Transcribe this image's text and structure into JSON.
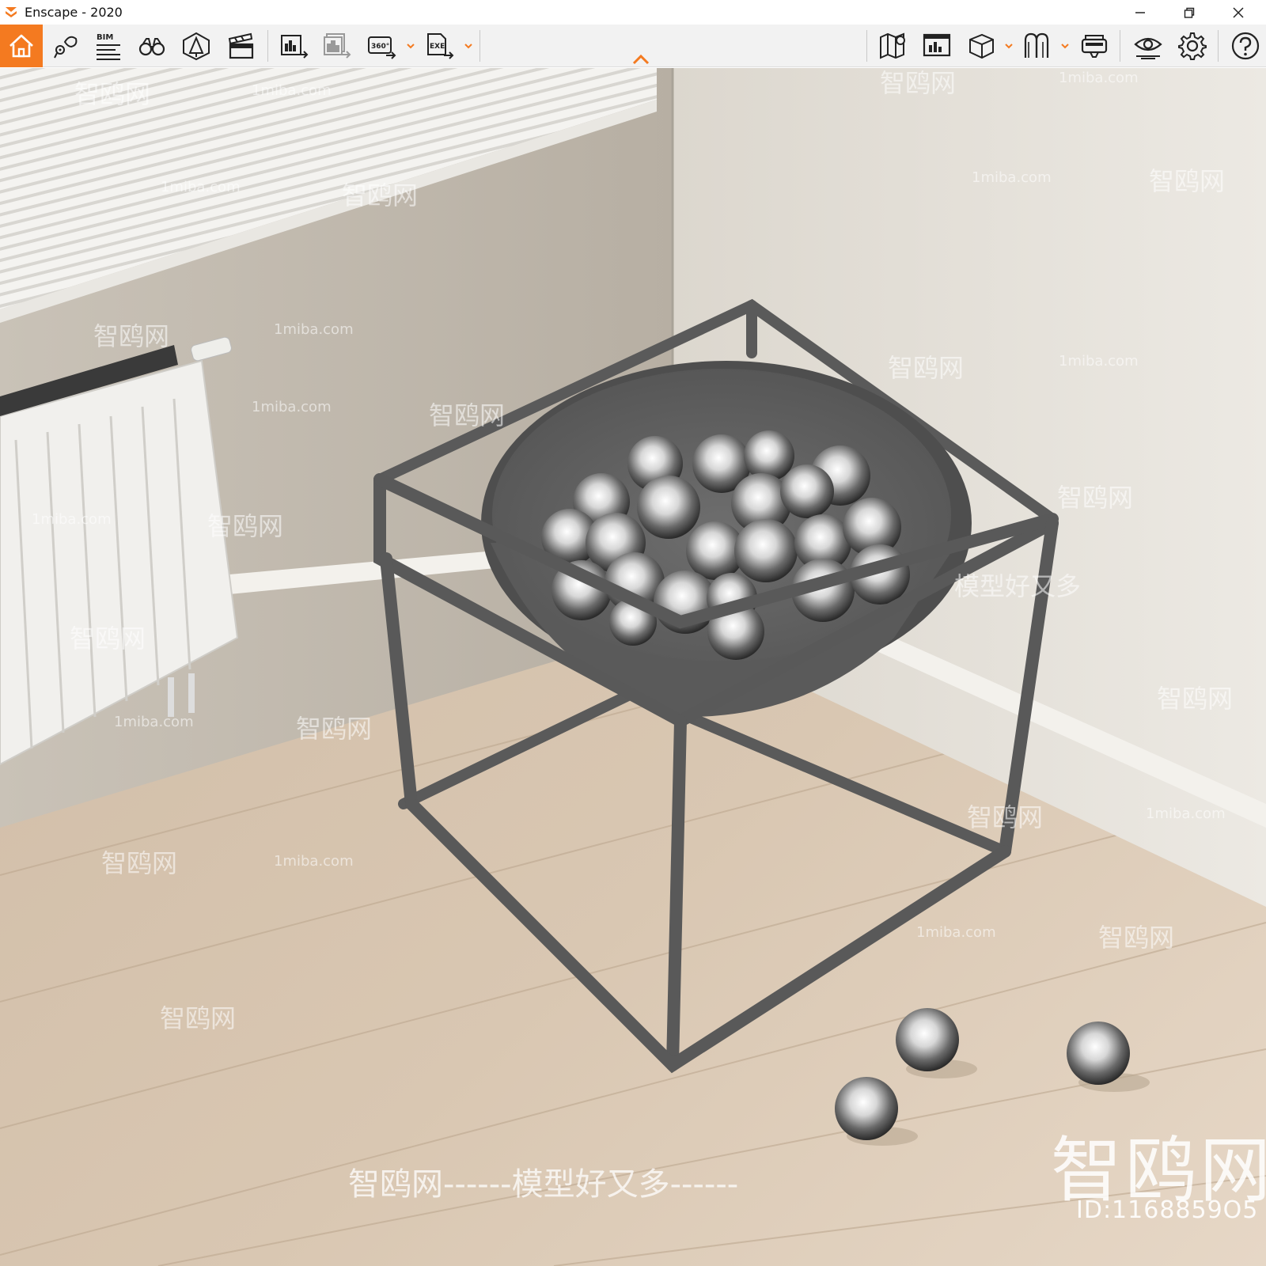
{
  "window": {
    "title": "Enscape - 2020",
    "accent_color": "#f47a20"
  },
  "toolbar": {
    "left_buttons": [
      {
        "name": "home-icon",
        "tooltip": ""
      },
      {
        "name": "view-management-icon"
      },
      {
        "name": "bim-icon",
        "label": "BIM"
      },
      {
        "name": "binoculars-icon"
      },
      {
        "name": "asset-library-icon"
      },
      {
        "name": "video-editor-icon"
      },
      {
        "name": "export-screenshot-icon"
      },
      {
        "name": "batch-render-icon"
      },
      {
        "name": "export-360-icon",
        "label": "360°"
      },
      {
        "name": "export-exe-icon",
        "label": "EXE"
      }
    ],
    "right_buttons": [
      {
        "name": "map-icon"
      },
      {
        "name": "export-web-icon"
      },
      {
        "name": "cube-icon"
      },
      {
        "name": "material-editor-icon"
      },
      {
        "name": "vr-headset-icon"
      },
      {
        "name": "eye-visual-settings-icon"
      },
      {
        "name": "gear-icon"
      },
      {
        "name": "help-icon"
      }
    ],
    "bim_label": "BIM",
    "label_360": "360°",
    "label_exe": "EXE"
  },
  "watermarks": {
    "site": "1miba.com",
    "brand": "智鸥网",
    "slogan": "模型好又多",
    "bottom_line": "智鸥网------模型好又多------",
    "big_brand": "智鸥网",
    "id_text": "ID:1168859O5"
  }
}
